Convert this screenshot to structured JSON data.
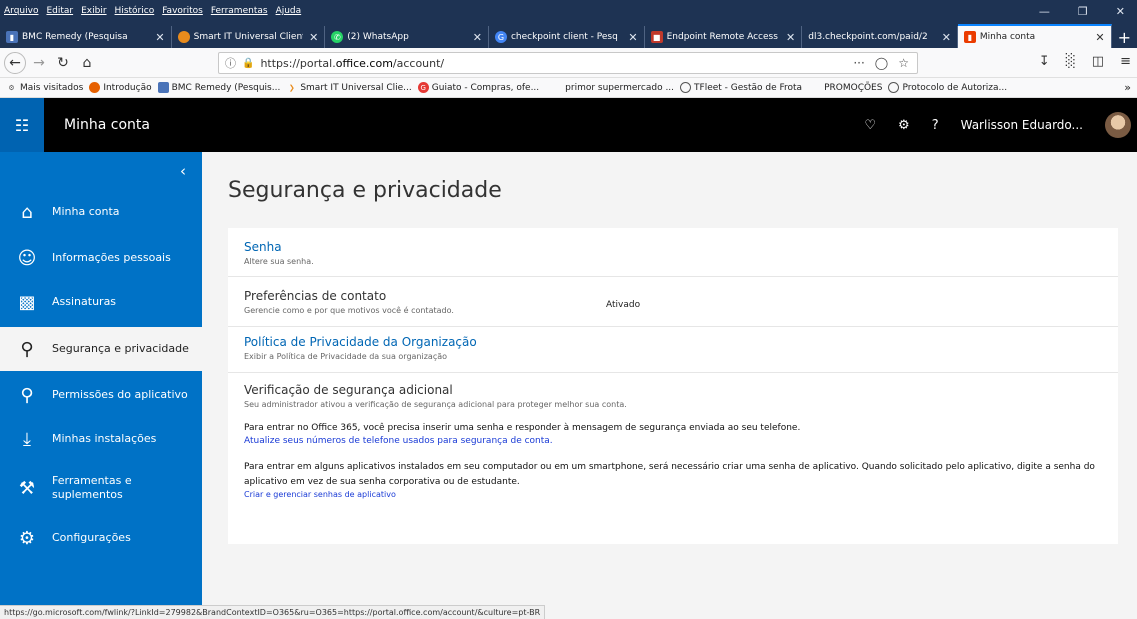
{
  "menubar": {
    "items": [
      "Arquivo",
      "Editar",
      "Exibir",
      "Histórico",
      "Favoritos",
      "Ferramentas",
      "Ajuda"
    ]
  },
  "tabs": [
    {
      "label": "BMC Remedy (Pesquisa",
      "icon_color": "#4a73b8"
    },
    {
      "label": "Smart IT Universal Client",
      "icon_color": "#e88b1c"
    },
    {
      "label": "(2) WhatsApp",
      "icon_color": "#25d366"
    },
    {
      "label": "checkpoint client - Pesq",
      "icon_color": "#4285f4"
    },
    {
      "label": "Endpoint Remote Access",
      "icon_color": "#c0392b"
    },
    {
      "label": "dl3.checkpoint.com/paid/2",
      "icon_color": "#888888"
    },
    {
      "label": "Minha conta",
      "icon_color": "#eb3c00"
    }
  ],
  "navbar": {
    "url_prefix": "https://portal.",
    "url_domain": "office.com",
    "url_suffix": "/account/"
  },
  "bookmarks": [
    {
      "label": "Mais visitados",
      "icon_color": "#555555"
    },
    {
      "label": "Introdução",
      "icon_color": "#e66000"
    },
    {
      "label": "BMC Remedy (Pesquis...",
      "icon_color": "#4a73b8"
    },
    {
      "label": "Smart IT Universal Clie...",
      "icon_color": "#e88b1c"
    },
    {
      "label": "Guiato - Compras, ofe...",
      "icon_color": "#e53935"
    },
    {
      "label": "primor supermercado ...",
      "icon_color": ""
    },
    {
      "label": "TFleet - Gestão de Frota",
      "icon_color": "#555555"
    },
    {
      "label": "PROMOÇÕES",
      "icon_color": ""
    },
    {
      "label": "Protocolo de Autoriza...",
      "icon_color": "#555555"
    }
  ],
  "header": {
    "app_title": "Minha conta",
    "user_name": "Warlisson Eduardo..."
  },
  "sidebar": {
    "items": [
      {
        "label": "Minha conta",
        "icon": "home-icon"
      },
      {
        "label": "Informações pessoais",
        "icon": "person-icon"
      },
      {
        "label": "Assinaturas",
        "icon": "card-icon"
      },
      {
        "label": "Segurança e privacidade",
        "icon": "key-icon",
        "selected": true
      },
      {
        "label": "Permissões do aplicativo",
        "icon": "lock-icon"
      },
      {
        "label": "Minhas instalações",
        "icon": "download-icon"
      },
      {
        "label": "Ferramentas e suplementos",
        "icon": "wrench-icon"
      },
      {
        "label": "Configurações",
        "icon": "gear-icon"
      }
    ]
  },
  "main": {
    "title": "Segurança e privacidade",
    "password": {
      "title": "Senha",
      "desc": "Altere sua senha."
    },
    "contact": {
      "title": "Preferências de contato",
      "desc": "Gerencie como e por que motivos você é contatado.",
      "status": "Ativado"
    },
    "privacy": {
      "title": "Política de Privacidade da Organização",
      "desc": "Exibir a Política de Privacidade da sua organização"
    },
    "verification": {
      "title": "Verificação de segurança adicional",
      "desc": "Seu administrador ativou a verificação de segurança adicional para proteger melhor sua conta.",
      "para1": "Para entrar no Office 365, você precisa inserir uma senha e responder à mensagem de segurança enviada ao seu telefone.",
      "link1": "Atualize seus números de telefone usados para segurança de conta.",
      "para2": "Para entrar em alguns aplicativos instalados em seu computador ou em um smartphone, será necessário criar uma senha de aplicativo. Quando solicitado pelo aplicativo, digite a senha do aplicativo em vez de sua senha corporativa ou de estudante.",
      "link2": "Criar e gerenciar senhas de aplicativo"
    }
  },
  "statusbar": {
    "url": "https://go.microsoft.com/fwlink/?LinkId=279982&BrandContextID=O365&ru=O365=https://portal.office.com/account/&culture=pt-BR"
  }
}
